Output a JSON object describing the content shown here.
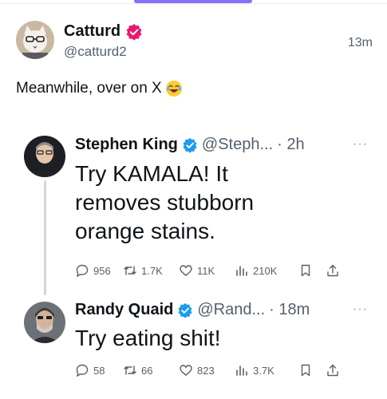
{
  "outer_post": {
    "name": "Catturd",
    "handle": "@catturd2",
    "time": "13m",
    "text": "Meanwhile, over on X",
    "emoji": "laughing-emoji"
  },
  "replies": [
    {
      "name": "Stephen King",
      "handle": "@Steph...",
      "time": "· 2h",
      "more": "···",
      "text_lines": [
        "Try KAMALA! It",
        "removes stubborn",
        "orange stains."
      ],
      "stats": {
        "replies": "956",
        "retweets": "1.7K",
        "likes": "11K",
        "views": "210K"
      }
    },
    {
      "name": "Randy Quaid",
      "handle": "@Rand...",
      "time": "· 18m",
      "more": "···",
      "text_lines": [
        "Try eating shit!"
      ],
      "stats": {
        "replies": "58",
        "retweets": "66",
        "likes": "823",
        "views": "3.7K"
      }
    }
  ],
  "colors": {
    "verified_pink": "#e8176f",
    "verified_blue": "#1d9bf0",
    "accent": "#7b61ff"
  }
}
